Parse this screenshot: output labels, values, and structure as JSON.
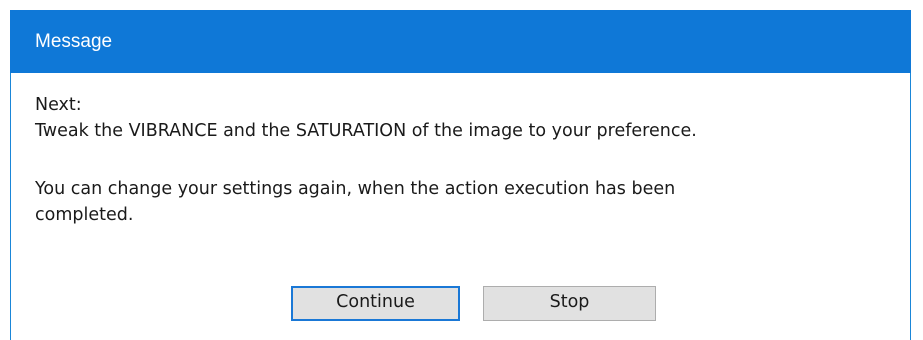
{
  "window": {
    "title": "Message"
  },
  "message": {
    "line1": "Next:",
    "line2": "Tweak the VIBRANCE and the SATURATION of the image to your preference.",
    "line3": "You can change your settings again, when the action execution has been",
    "line4": "completed."
  },
  "buttons": {
    "continue_label": "Continue",
    "stop_label": "Stop"
  },
  "colors": {
    "titlebar": "#0f78d7",
    "title_text": "#ffffff",
    "button_face": "#e1e1e1",
    "focus_border": "#1a78d6"
  }
}
